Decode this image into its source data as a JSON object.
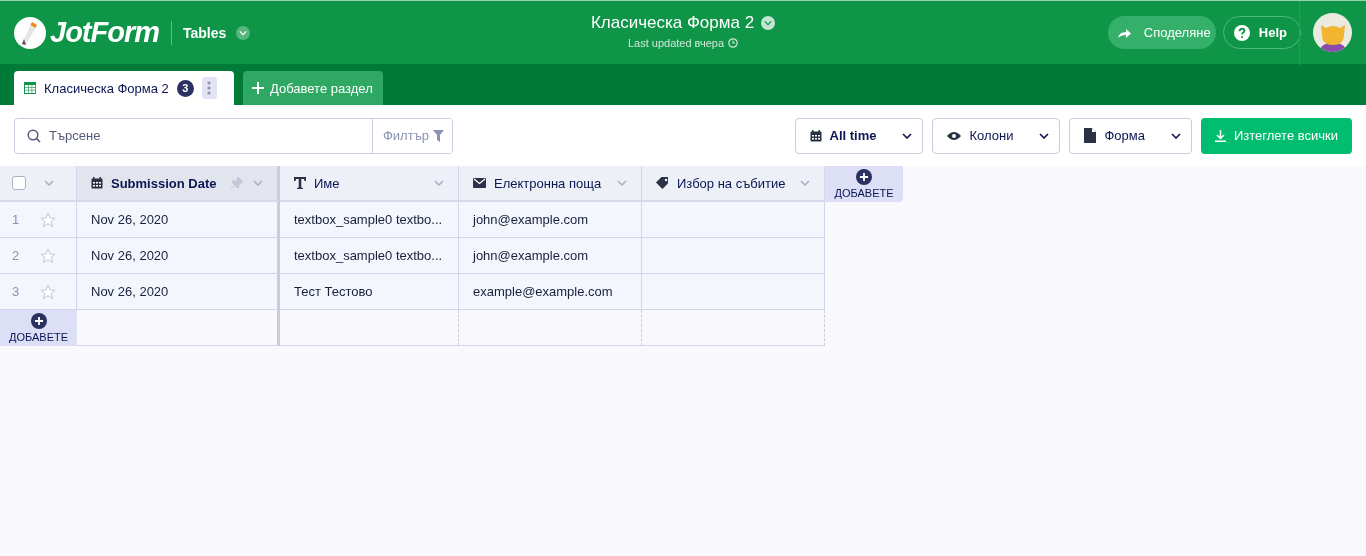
{
  "header": {
    "logo": "JotForm",
    "product": "Tables",
    "title": "Класическа Форма 2",
    "subtitle": "Last updated вчера",
    "share": "Споделяне",
    "help": "Help"
  },
  "tabs": [
    {
      "label": "Класическа Форма 2",
      "count": "3",
      "selected": true
    }
  ],
  "add_tab": "Добавете раздел",
  "toolbar": {
    "search": {
      "placeholder": "Търсене"
    },
    "filter": "Филтър",
    "buttons": [
      {
        "label": "All time",
        "kind": "calendar"
      },
      {
        "label": "Колони",
        "kind": "eye"
      },
      {
        "label": "Форма",
        "kind": "document"
      }
    ],
    "download": "Изтеглете всички"
  },
  "table": {
    "select_all": {
      "checked": false
    },
    "columns": [
      {
        "label": "Submission Date",
        "kind": "calendar",
        "pinned": true
      },
      {
        "label": "Име",
        "kind": "text",
        "pinned": false
      },
      {
        "label": "Електронна поща",
        "kind": "email",
        "pinned": false
      },
      {
        "label": "Избор на събитие",
        "kind": "tag",
        "pinned": false
      }
    ],
    "add_column": "ДОБАВЕТЕ",
    "rows": [
      {
        "number": "1",
        "starred": false,
        "cells": [
          "Nov 26, 2020",
          "textbox_sample0 textbo...",
          "john@example.com",
          ""
        ]
      },
      {
        "number": "2",
        "starred": false,
        "cells": [
          "Nov 26, 2020",
          "textbox_sample0 textbo...",
          "john@example.com",
          ""
        ]
      },
      {
        "number": "3",
        "starred": false,
        "cells": [
          "Nov 26, 2020",
          "Тест Тестово",
          "example@example.com",
          ""
        ]
      }
    ],
    "add_row": "ДОБАВЕТЕ"
  }
}
